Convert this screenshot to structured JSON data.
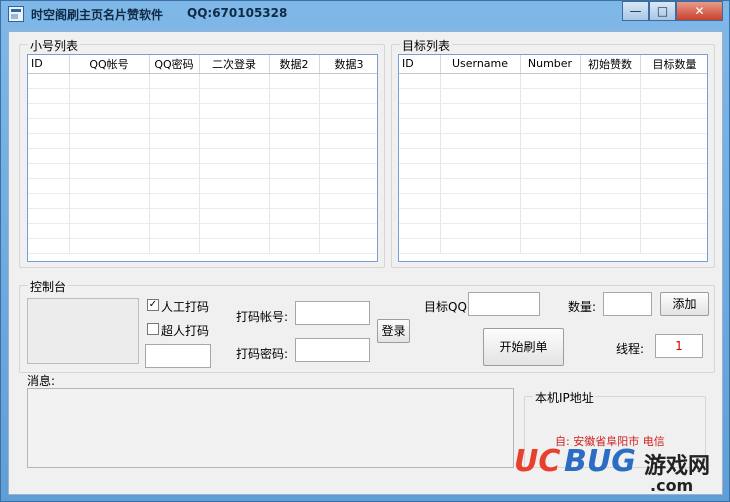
{
  "window": {
    "title": "时空阁刷主页名片赞软件",
    "qq": "QQ:670105328",
    "min_glyph": "—",
    "max_glyph": "□",
    "close_glyph": "✕"
  },
  "account_list": {
    "label": "小号列表",
    "columns": [
      "ID",
      "QQ帐号",
      "QQ密码",
      "二次登录",
      "数据2",
      "数据3"
    ]
  },
  "target_list": {
    "label": "目标列表",
    "columns": [
      "ID",
      "Username",
      "Number",
      "初始赞数",
      "目标数量"
    ]
  },
  "console": {
    "label": "控制台",
    "manual_captcha": "人工打码",
    "manual_captcha_checked": "✓",
    "super_captcha": "超人打码",
    "captcha_account_label": "打码帐号:",
    "captcha_password_label": "打码密码:",
    "login_button": "登录",
    "target_qq_label": "目标QQ:",
    "count_label": "数量:",
    "add_button": "添加",
    "start_button": "开始刷单",
    "threads_label": "线程:",
    "threads_value": "1"
  },
  "messages": {
    "label": "消息:"
  },
  "local_ip": {
    "label": "本机IP地址",
    "location": "自: 安徽省阜阳市 电信"
  },
  "watermark": {
    "brand_uc": "UC",
    "brand_bug": "BUG",
    "brand_cn": "游戏网",
    "domain": ".com"
  },
  "colors": {
    "title_bar": "#5f9ed6",
    "ip_text": "#d02020",
    "watermark_uc": "#e8402c",
    "watermark_bug": "#2b6cc4"
  }
}
